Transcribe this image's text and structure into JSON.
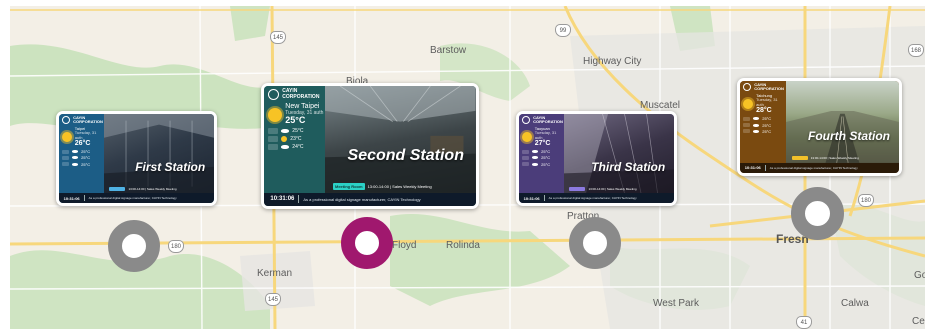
{
  "map": {
    "background": "#f3efe6",
    "green": "#bfdfb2",
    "urban": "#e6e5e2",
    "road_major": "#f7d77c",
    "road_minor": "#ffffff",
    "places": {
      "barstow": "Barstow",
      "highway_city": "Highway City",
      "muscatel": "Muscatel",
      "biola": "Biola",
      "floyd": "Floyd",
      "rolinda": "Rolinda",
      "kerman": "Kerman",
      "pratton": "Pratton",
      "fresno": "Fresn",
      "west_park": "West Park",
      "calwa": "Calwa",
      "gold": "Gold",
      "ce": "Ce"
    },
    "shields": {
      "s145_top": "145",
      "s99_top": "99",
      "s168": "168",
      "s180_left": "180",
      "s145_bottom": "145",
      "s180_right": "180",
      "s41": "41"
    }
  },
  "brand": {
    "line1": "CAYIN",
    "line2": "CORPORATION"
  },
  "screens": [
    {
      "id": "first",
      "station": "First Station",
      "city": "Taipei",
      "date": "Tuesday, 31 auth",
      "temp": "26°C",
      "forecast": [
        "25°C",
        "25°C",
        "25°C"
      ],
      "time": "10:31:06",
      "ticker": "As a professional digital signage manufacturer, CAYIN Technology",
      "meeting": "13:00-14:00 | Sales Weekly Meeting",
      "colors": {
        "left": "#1c5d86",
        "photo": "#2f3a48",
        "accent": "#4fb2e4"
      }
    },
    {
      "id": "second",
      "station": "Second Station",
      "city": "New Taipei",
      "date": "Tuesday, 31 auth",
      "temp": "25°C",
      "forecast": [
        "25°C",
        "23°C",
        "24°C"
      ],
      "time": "10:31:06",
      "ticker": "As a professional digital signage manufacturer, CAYIN Technology",
      "meeting": "13:00-14:00 | Sales Weekly Meeting",
      "meeting_tag": "Meeting Room",
      "colors": {
        "left": "#1f5c5d",
        "photo": "#333a3c",
        "accent": "#2bd1c6"
      }
    },
    {
      "id": "third",
      "station": "Third Station",
      "city": "Taoyuan",
      "date": "Tuesday, 31 auth",
      "temp": "27°C",
      "forecast": [
        "25°C",
        "25°C",
        "25°C"
      ],
      "time": "10:31:06",
      "ticker": "As a professional digital signage manufacturer, CAYIN Technology",
      "meeting": "13:00-14:00 | Sales Weekly Meeting",
      "colors": {
        "left": "#4b3d7a",
        "photo": "#3a3448",
        "accent": "#8c7ae0"
      }
    },
    {
      "id": "fourth",
      "station": "Fourth Station",
      "city": "Taichung",
      "date": "Tuesday, 31 auth",
      "temp": "28°C",
      "forecast": [
        "25°C",
        "25°C",
        "25°C"
      ],
      "time": "10:31:06",
      "ticker": "As a professional digital signage manufacturer, CAYIN Technology",
      "meeting": "13:00-14:00 | Sales Weekly Meeting",
      "colors": {
        "left": "#7a4a10",
        "photo": "#6f6a4a",
        "accent": "#f2c02a"
      }
    }
  ],
  "markers": [
    {
      "id": "first",
      "color": "#8a8a8a",
      "active": false
    },
    {
      "id": "second",
      "color": "#a0186e",
      "active": true
    },
    {
      "id": "third",
      "color": "#8a8a8a",
      "active": false
    },
    {
      "id": "fourth",
      "color": "#8a8a8a",
      "active": false
    }
  ]
}
